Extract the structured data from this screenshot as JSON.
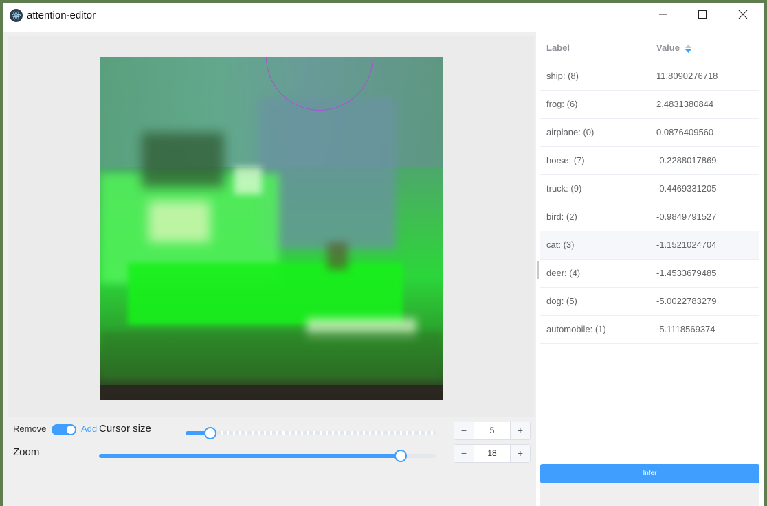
{
  "window": {
    "title": "attention-editor"
  },
  "controls": {
    "mode_remove_label": "Remove",
    "mode_add_label": "Add",
    "mode_is_add": true,
    "cursor_size_label": "Cursor size",
    "cursor_size_value": "5",
    "cursor_size_fraction": 0.1,
    "zoom_label": "Zoom",
    "zoom_value": "18",
    "zoom_fraction": 0.895,
    "decrement_symbol": "−",
    "increment_symbol": "+"
  },
  "table": {
    "col_label": "Label",
    "col_value": "Value",
    "rows": [
      {
        "label": "ship: (8)",
        "value": "11.8090276718"
      },
      {
        "label": "frog: (6)",
        "value": "2.4831380844"
      },
      {
        "label": "airplane: (0)",
        "value": "0.0876409560"
      },
      {
        "label": "horse: (7)",
        "value": "-0.2288017869"
      },
      {
        "label": "truck: (9)",
        "value": "-0.4469331205"
      },
      {
        "label": "bird: (2)",
        "value": "-0.9849791527"
      },
      {
        "label": "cat: (3)",
        "value": "-1.1521024704"
      },
      {
        "label": "deer: (4)",
        "value": "-1.4533679485"
      },
      {
        "label": "dog: (5)",
        "value": "-5.0022783279"
      },
      {
        "label": "automobile: (1)",
        "value": "-5.1118569374"
      }
    ]
  },
  "infer_button": "Infer",
  "colors": {
    "accent": "#409eff",
    "brush_ring": "#b34bd6"
  }
}
